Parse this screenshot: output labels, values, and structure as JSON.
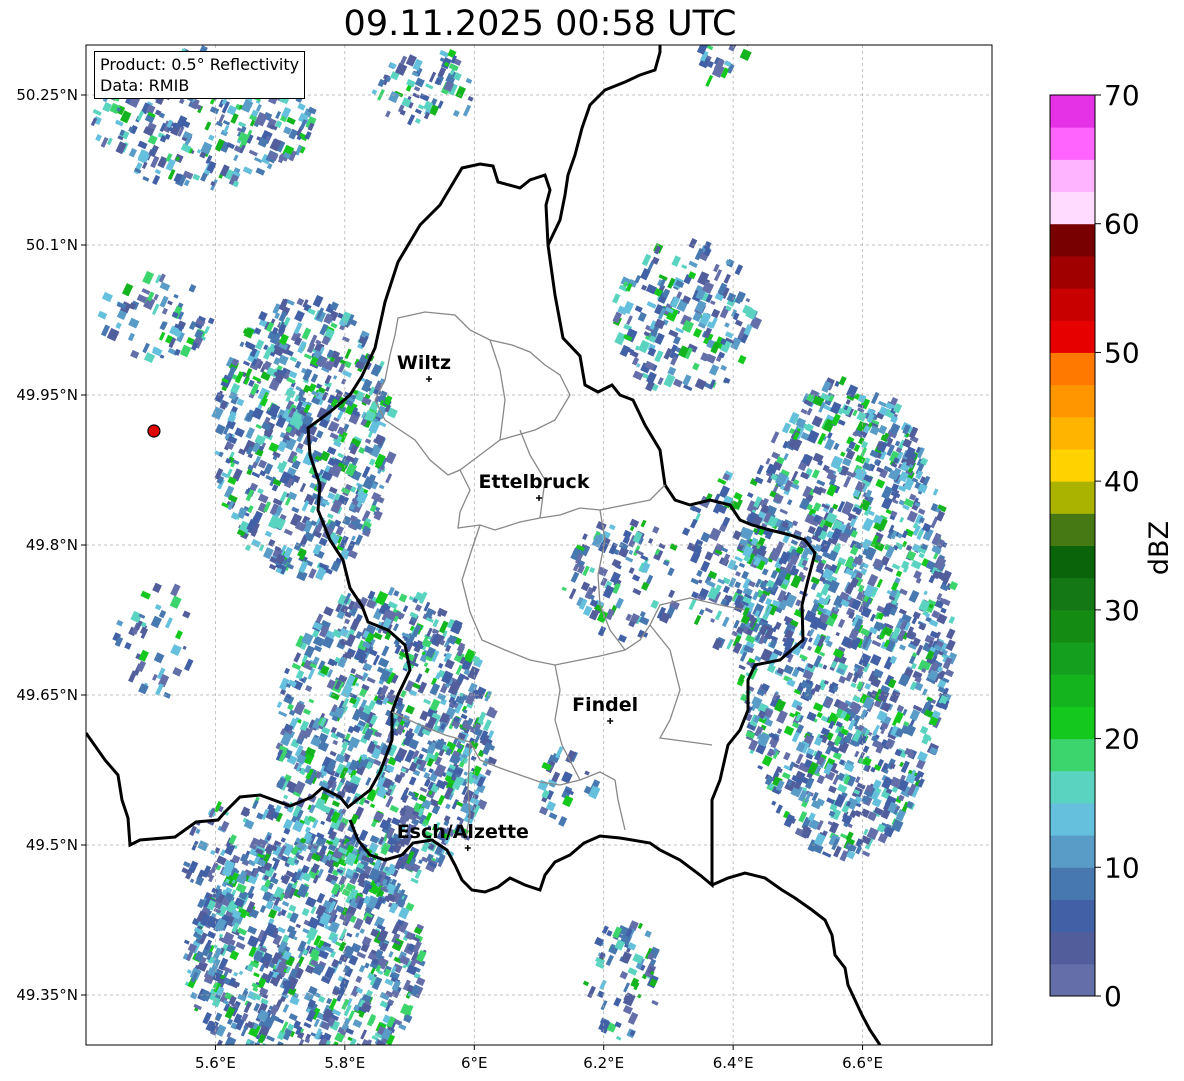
{
  "title": "09.11.2025 00:58 UTC",
  "info": {
    "product": "Product: 0.5° Reflectivity",
    "data": "Data: RMIB"
  },
  "map": {
    "lon_range": [
      5.4,
      6.8
    ],
    "lat_range": [
      49.3,
      50.3
    ],
    "lon_ticks": [
      "5.6°E",
      "5.8°E",
      "6°E",
      "6.2°E",
      "6.4°E",
      "6.6°E"
    ],
    "lon_tick_values": [
      5.6,
      5.8,
      6.0,
      6.2,
      6.4,
      6.6
    ],
    "lat_ticks": [
      "50.25°N",
      "50.1°N",
      "49.95°N",
      "49.8°N",
      "49.65°N",
      "49.5°N",
      "49.35°N"
    ],
    "lat_tick_values": [
      50.25,
      50.1,
      49.95,
      49.8,
      49.65,
      49.5,
      49.35
    ],
    "gridlines": true,
    "cities": [
      {
        "name": "Wiltz",
        "lon": 5.93,
        "lat": 49.966
      },
      {
        "name": "Ettelbruck",
        "lon": 6.1,
        "lat": 49.847
      },
      {
        "name": "Findel",
        "lon": 6.21,
        "lat": 49.624
      },
      {
        "name": "Esch/Alzette",
        "lon": 5.99,
        "lat": 49.497
      }
    ],
    "radar_site": {
      "lon": 5.505,
      "lat": 49.914,
      "color": "#e00000"
    }
  },
  "colorbar": {
    "label": "dBZ",
    "tick_labels": [
      "0",
      "10",
      "20",
      "30",
      "40",
      "50",
      "60",
      "70"
    ],
    "tick_values": [
      0,
      10,
      20,
      30,
      40,
      50,
      60,
      70
    ],
    "step": 2.5,
    "colors": [
      "#646ea8",
      "#525e9c",
      "#4160a6",
      "#4878b0",
      "#5a9cc8",
      "#64c0dc",
      "#5ad4c0",
      "#3cd46c",
      "#14c81e",
      "#14b41e",
      "#14a01e",
      "#148c14",
      "#147814",
      "#0a640a",
      "#467814",
      "#aab400",
      "#ffd200",
      "#ffb400",
      "#ff9600",
      "#ff7800",
      "#e60000",
      "#c80000",
      "#a00000",
      "#780000",
      "#ffdcff",
      "#ffb4ff",
      "#ff64ff",
      "#e632e6"
    ]
  }
}
